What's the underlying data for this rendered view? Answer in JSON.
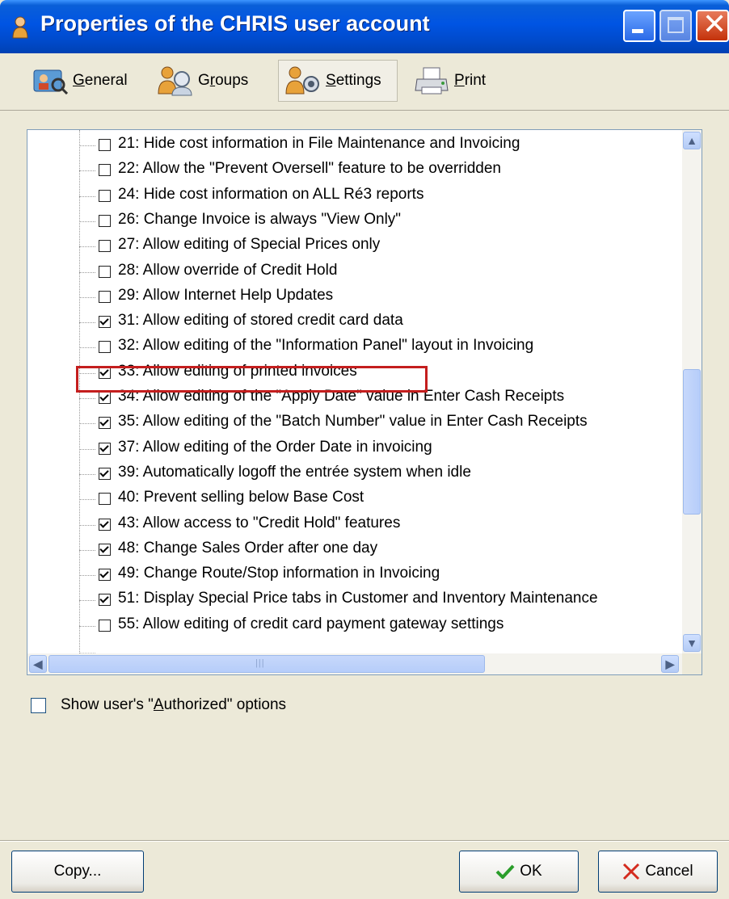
{
  "window": {
    "title": "Properties of the CHRIS user account"
  },
  "toolbar": {
    "tabs": [
      {
        "label_pre": "",
        "label_ul": "G",
        "label_post": "eneral",
        "icon": "general-icon"
      },
      {
        "label_pre": "G",
        "label_ul": "r",
        "label_post": "oups",
        "icon": "groups-icon"
      },
      {
        "label_pre": "",
        "label_ul": "S",
        "label_post": "ettings",
        "icon": "settings-icon",
        "active": true
      },
      {
        "label_pre": "",
        "label_ul": "P",
        "label_post": "rint",
        "icon": "print-icon"
      }
    ]
  },
  "settings": {
    "items": [
      {
        "label": "21: Hide cost information in File Maintenance and Invoicing",
        "checked": false
      },
      {
        "label": "22: Allow the \"Prevent Oversell\" feature to be overridden",
        "checked": false
      },
      {
        "label": "24: Hide cost information on ALL Ré3 reports",
        "checked": false
      },
      {
        "label": "26: Change Invoice is always \"View Only\"",
        "checked": false
      },
      {
        "label": "27: Allow editing of Special Prices only",
        "checked": false
      },
      {
        "label": "28: Allow override of Credit Hold",
        "checked": false
      },
      {
        "label": "29: Allow Internet Help Updates",
        "checked": false
      },
      {
        "label": "31: Allow editing of stored credit card data",
        "checked": true
      },
      {
        "label": "32: Allow editing of the \"Information Panel\" layout in Invoicing",
        "checked": false
      },
      {
        "label": "33: Allow editing of printed invoices",
        "checked": true,
        "highlighted": true
      },
      {
        "label": "34: Allow editing of the \"Apply Date\" value in Enter Cash Receipts",
        "checked": true
      },
      {
        "label": "35: Allow editing of the \"Batch Number\" value in Enter Cash Receipts",
        "checked": true
      },
      {
        "label": "37: Allow editing of the Order Date in invoicing",
        "checked": true
      },
      {
        "label": "39: Automatically logoff the entrée system when idle",
        "checked": true
      },
      {
        "label": "40: Prevent selling below Base Cost",
        "checked": false
      },
      {
        "label": "43: Allow access to \"Credit Hold\" features",
        "checked": true
      },
      {
        "label": "48: Change Sales Order after one day",
        "checked": true
      },
      {
        "label": "49: Change Route/Stop information in Invoicing",
        "checked": true
      },
      {
        "label": "51: Display Special Price tabs in Customer and Inventory Maintenance",
        "checked": true
      },
      {
        "label": "55: Allow editing of credit card payment gateway settings",
        "checked": false
      }
    ]
  },
  "show_authorized": {
    "label_pre": "Show user's \"",
    "label_ul": "A",
    "label_post": "uthorized\" options",
    "checked": false
  },
  "buttons": {
    "copy": "Copy...",
    "ok": "OK",
    "cancel": "Cancel"
  },
  "colors": {
    "titlebar": "#0054e3",
    "highlight_border": "#c41e1e",
    "dialog_bg": "#ece9d8"
  }
}
